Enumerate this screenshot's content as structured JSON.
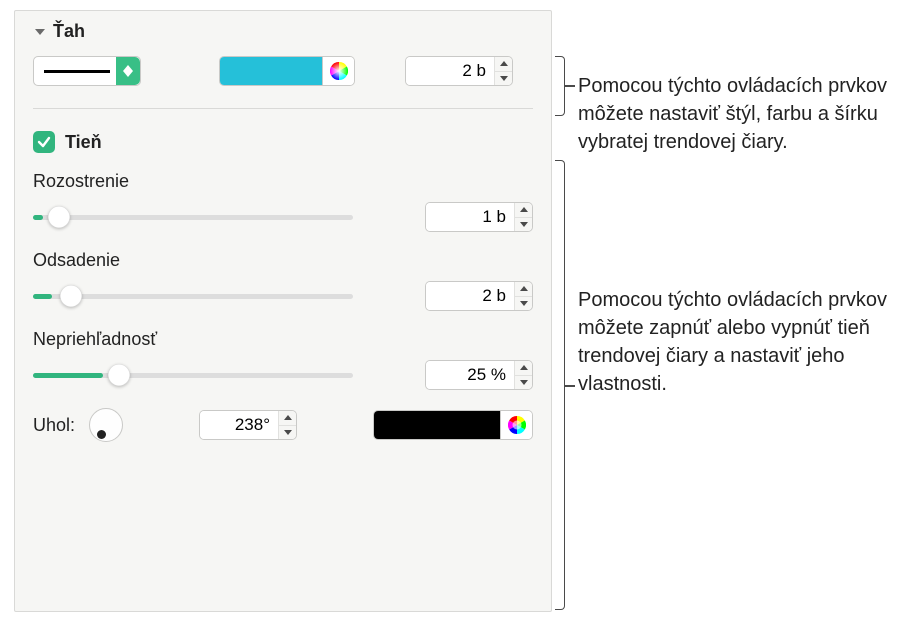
{
  "stroke": {
    "title": "Ťah",
    "width_value": "2 b",
    "color": "#25c0d9"
  },
  "shadow": {
    "label": "Tieň",
    "checked": true,
    "blur": {
      "label": "Rozostrenie",
      "value": "1 b",
      "fill_pct": 3,
      "thumb_pct": 8
    },
    "offset": {
      "label": "Odsadenie",
      "value": "2 b",
      "fill_pct": 6,
      "thumb_pct": 12
    },
    "opacity": {
      "label": "Nepriehľadnosť",
      "value": "25 %",
      "fill_pct": 22,
      "thumb_pct": 27
    },
    "angle": {
      "label": "Uhol:",
      "value": "238°"
    },
    "color": "#000000"
  },
  "callouts": {
    "stroke_help": "Pomocou týchto ovládacích prvkov môžete nastaviť štýl, farbu a šírku vybratej trendovej čiary.",
    "shadow_help": "Pomocou týchto ovládacích prvkov môžete zapnúť alebo vypnúť tieň trendovej čiary a nastaviť jeho vlastnosti."
  }
}
